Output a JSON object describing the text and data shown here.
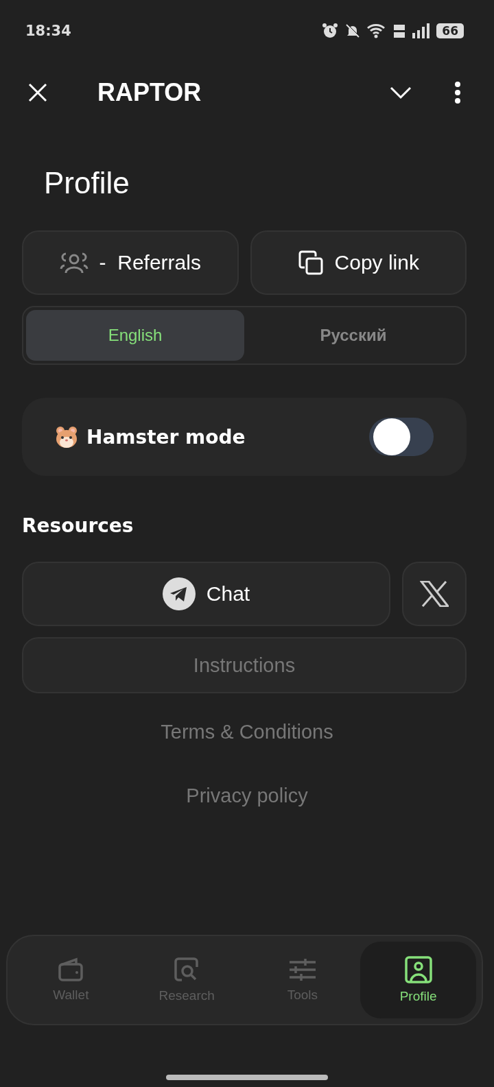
{
  "status_bar": {
    "time": "18:34",
    "battery": "66"
  },
  "header": {
    "title": "RAPTOR"
  },
  "page_title": "Profile",
  "actions": [
    {
      "kind": "referrals",
      "label": "-  Referrals"
    },
    {
      "kind": "copy",
      "label": "Copy link"
    }
  ],
  "languages": [
    {
      "label": "English",
      "selected": true
    },
    {
      "label": "Русский",
      "selected": false
    }
  ],
  "hamster_mode": {
    "label": "Hamster mode",
    "on": false
  },
  "resources": {
    "heading": "Resources",
    "chat": "Chat",
    "instructions": "Instructions",
    "links": [
      "Terms & Conditions",
      "Privacy policy"
    ]
  },
  "nav": [
    {
      "kind": "wallet",
      "label": "Wallet",
      "selected": false
    },
    {
      "kind": "research",
      "label": "Research",
      "selected": false
    },
    {
      "kind": "tools",
      "label": "Tools",
      "selected": false
    },
    {
      "kind": "profile",
      "label": "Profile",
      "selected": true
    }
  ]
}
